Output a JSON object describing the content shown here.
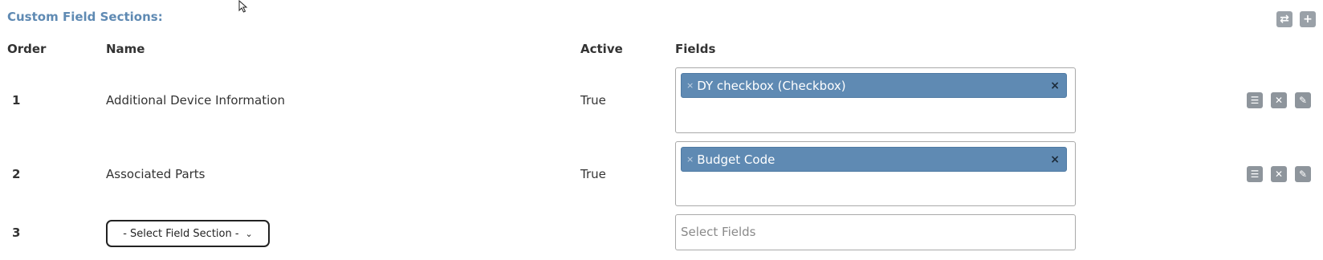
{
  "header": {
    "title": "Custom Field Sections:",
    "swap_icon": "swap-icon",
    "add_icon": "plus-icon"
  },
  "columns": {
    "order": "Order",
    "name": "Name",
    "active": "Active",
    "fields": "Fields"
  },
  "rows": [
    {
      "order": "1",
      "name": "Additional Device Information",
      "active": "True",
      "field_tag": "DY checkbox (Checkbox)"
    },
    {
      "order": "2",
      "name": "Associated Parts",
      "active": "True",
      "field_tag": "Budget Code"
    }
  ],
  "new_row": {
    "order": "3",
    "select_value": "- Select Field Section -",
    "fields_placeholder": "Select Fields"
  },
  "row_actions": {
    "list_icon": "list-icon",
    "delete_icon": "close-icon",
    "edit_icon": "pencil-icon"
  },
  "colors": {
    "accent": "#5f8ab3",
    "button_gray": "#8e959c"
  }
}
